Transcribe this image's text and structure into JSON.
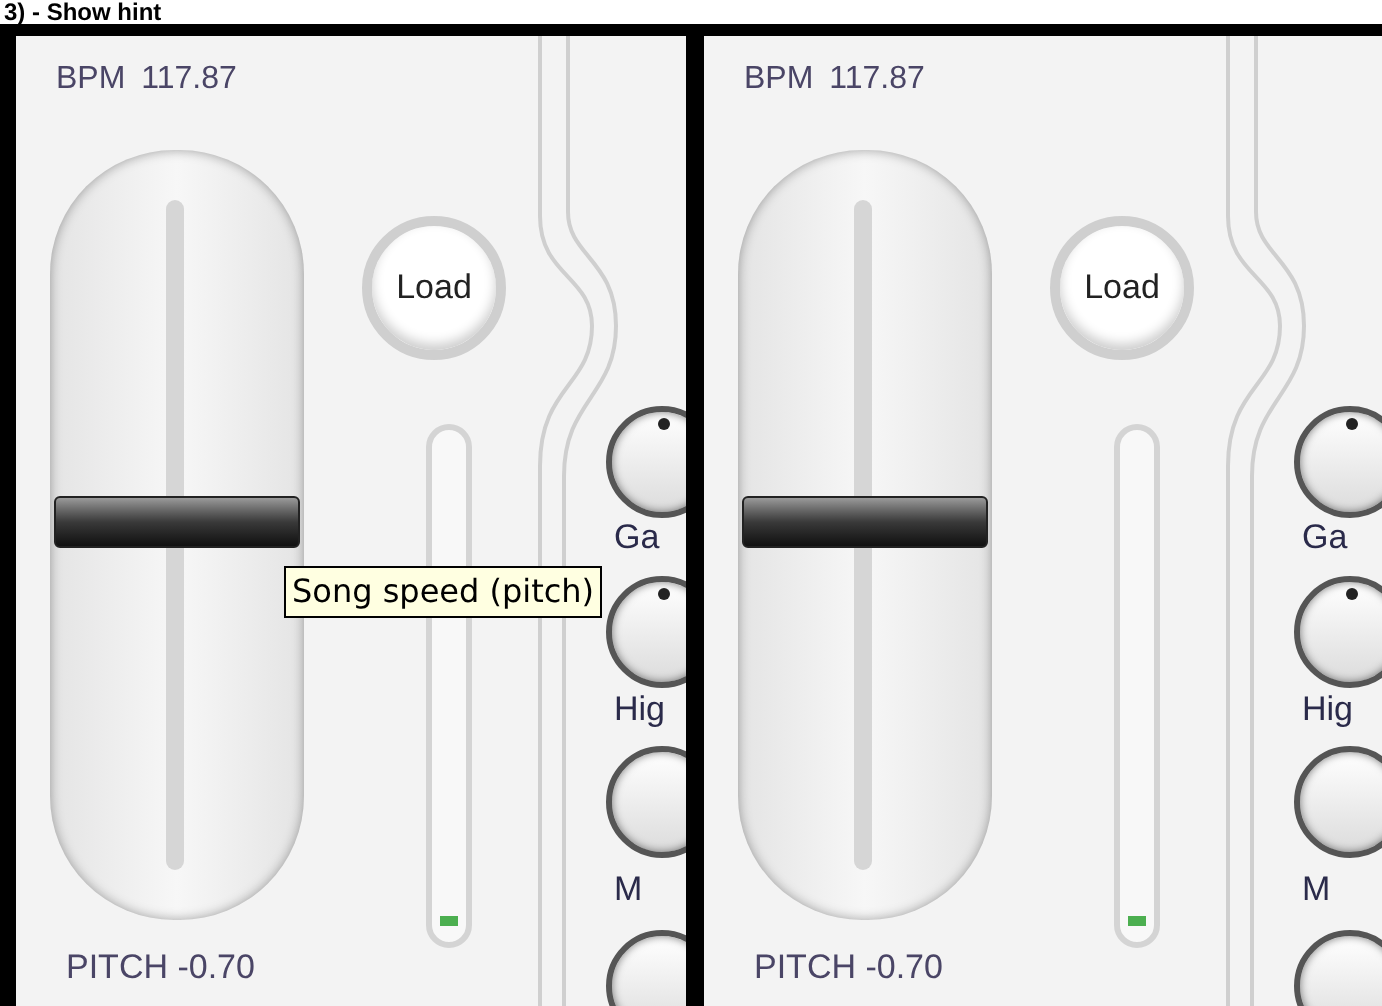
{
  "heading": "3) - Show hint",
  "panels": [
    {
      "bpm_label": "BPM",
      "bpm": "117.87",
      "pitch": "PITCH -0.70",
      "pitch_slider": {
        "level": 0.52
      },
      "load_button": "Load",
      "meter": {
        "level": 0.02
      },
      "knob_labels": [
        "Ga",
        "Hig",
        "M"
      ],
      "tooltip": "Song speed (pitch)"
    },
    {
      "bpm_label": "BPM",
      "bpm": "117.87",
      "pitch": "PITCH -0.70",
      "pitch_slider": {
        "level": 0.52
      },
      "load_button": "Load",
      "meter": {
        "level": 0.02
      },
      "knob_labels": [
        "Ga",
        "Hig",
        "M"
      ]
    }
  ]
}
